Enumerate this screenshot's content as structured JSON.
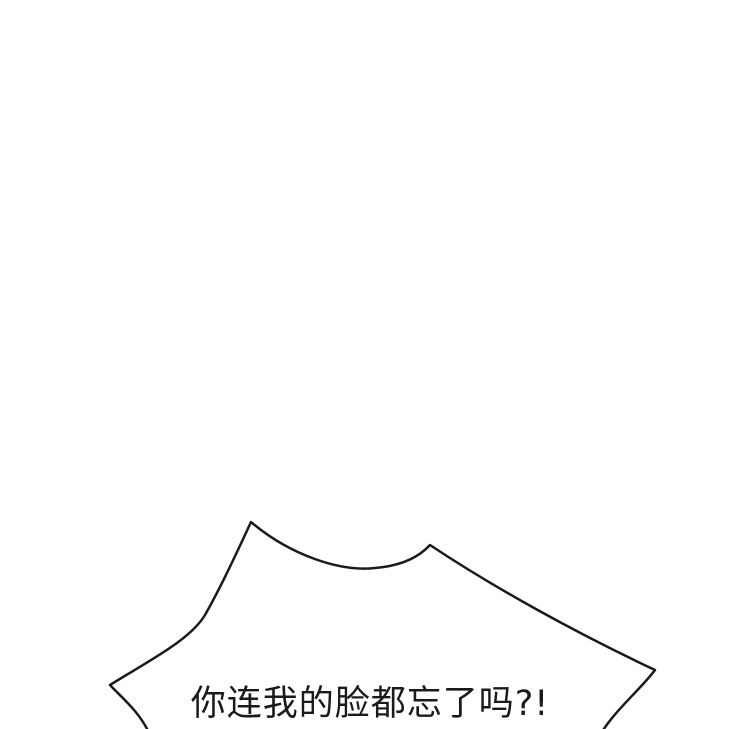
{
  "comic_panel": {
    "background_color": "#ffffff",
    "speech_bubble": {
      "shape": "spiky-shout",
      "fill_color": "#ffffff",
      "outline_color": "#1a1a1a",
      "text": "你连我的脸都忘了吗?!"
    }
  }
}
